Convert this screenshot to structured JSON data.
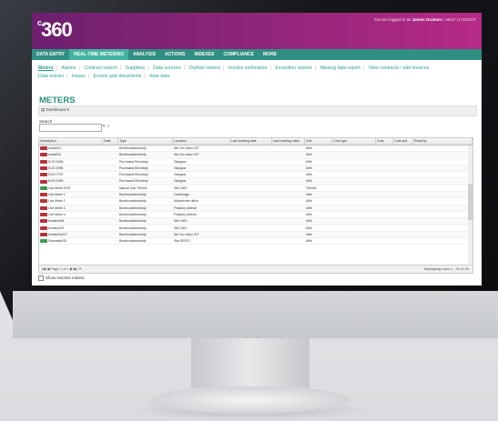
{
  "app": {
    "logo": "360",
    "user_prefix": "You are logged in as",
    "user_name": "James Graham",
    "help": "HELP",
    "logout": "LOGOUT"
  },
  "nav": [
    "DATA ENTRY",
    "REAL-TIME METERING",
    "ANALYSIS",
    "ACTIONS",
    "INDEXES",
    "COMPLIANCE",
    "MORE"
  ],
  "subnav": [
    "Meters",
    "Alarms",
    "Contract search",
    "Suppliers",
    "Data sources",
    "Orphan meters",
    "Invoice verification",
    "Exception reports",
    "Missing data report",
    "View contracts / add invoices",
    "Data extract",
    "Issues",
    "Events and documents",
    "Raw data"
  ],
  "page": {
    "title": "METERS",
    "dashboard_btn": "Dashboard"
  },
  "search": {
    "label": "Search",
    "value": ""
  },
  "table": {
    "headers": [
      "Description",
      "Date",
      "Type",
      "Location",
      "Last reading date",
      "Last reading value",
      "Unit",
      "Cost type",
      "Cost",
      "Cost unit",
      "Read by"
    ],
    "rows": [
      {
        "icon": "red",
        "desc": "Asset001",
        "type": "Boreboostelectricity",
        "loc": "Nie Zoo mezz 007",
        "unit": "kWh"
      },
      {
        "icon": "red",
        "desc": "Asset002",
        "type": "Boreboostelectricity",
        "loc": "Nie Zoo mezz 007",
        "unit": "kWh"
      },
      {
        "icon": "red",
        "desc": "ELEC0005",
        "type": "Purchased Electricity",
        "loc": "Glasgow",
        "unit": "kWh"
      },
      {
        "icon": "red",
        "desc": "ELEC0096",
        "type": "Purchased Electricity",
        "loc": "Glasgow",
        "unit": "kWh"
      },
      {
        "icon": "red",
        "desc": "ELEC7797",
        "type": "Purchased Electricity",
        "loc": "Glasgow",
        "unit": "kWh"
      },
      {
        "icon": "red",
        "desc": "ELEC0499",
        "type": "Purchased Electricity",
        "loc": "Glasgow",
        "unit": "kWh"
      },
      {
        "icon": "green",
        "desc": "Gas Meter 0076",
        "type": "Natural Gas Therms",
        "loc": "Site 1500",
        "unit": "Therms"
      },
      {
        "icon": "red",
        "desc": "Live Meter 1",
        "type": "Boreboostelectricity",
        "loc": "Cambridge",
        "unit": "kWh"
      },
      {
        "icon": "red",
        "desc": "Live Meter 2",
        "type": "Boreboostelectricity",
        "loc": "Manchester office",
        "unit": "kWh"
      },
      {
        "icon": "red",
        "desc": "Live Meter 3",
        "type": "Boreboostelectricity",
        "loc": "Finsbury Avenue",
        "unit": "kWh"
      },
      {
        "icon": "red",
        "desc": "Live Meter 4",
        "type": "Boreboostelectricity",
        "loc": "Finsbury Avenue",
        "unit": "kWh"
      },
      {
        "icon": "red",
        "desc": "Monitor008",
        "type": "Boreboostelectricity",
        "loc": "Site 1500",
        "unit": "kWh"
      },
      {
        "icon": "red",
        "desc": "Monitor009",
        "type": "Boreboostelectricity",
        "loc": "Site 1500",
        "unit": "kWh"
      },
      {
        "icon": "red",
        "desc": "Monitor0n047",
        "type": "Boreboostelectricity",
        "loc": "Nie Zoo mezz 007",
        "unit": "kWh"
      },
      {
        "icon": "green",
        "desc": "Submeter020",
        "type": "Boreboostelectricity",
        "loc": "Site 825797",
        "unit": "kWh"
      }
    ]
  },
  "pager": {
    "controls": "|◀  ◀  Page 1  of 1  ▶  ▶|  ⟳",
    "display": "Displaying rows 1 - 20 of 20"
  },
  "inactive_label": "Show inactive meters"
}
